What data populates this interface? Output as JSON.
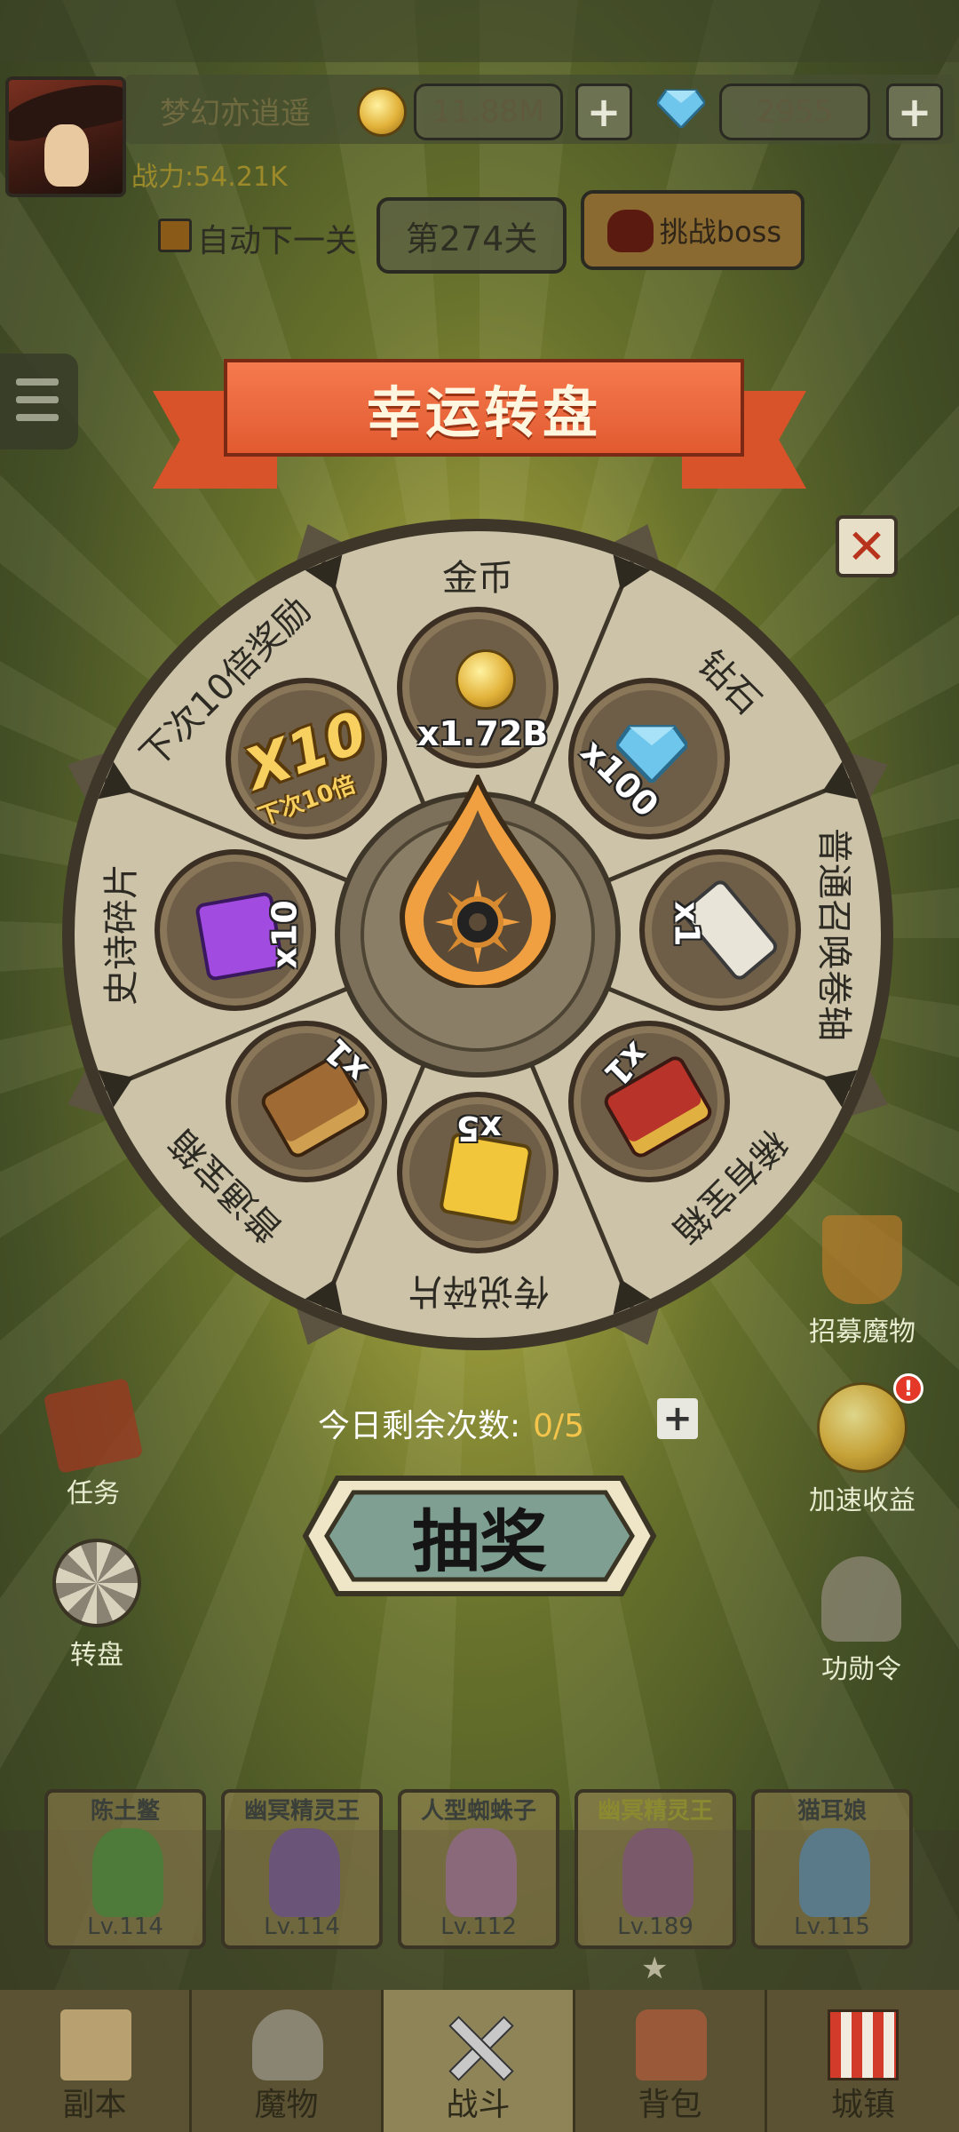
{
  "header": {
    "player_name": "梦幻亦逍遥",
    "gold": "11.88M",
    "diamonds": "2955",
    "power_label": "战力:54.21K",
    "auto_next_label": "自动下一关",
    "stage_label": "第274关",
    "boss_label": "挑战boss"
  },
  "wheel": {
    "title": "幸运转盘",
    "segments": [
      {
        "label": "金币",
        "qty": "x1.72B",
        "icon": "gold-coin-icon"
      },
      {
        "label": "钻石",
        "qty": "x100",
        "icon": "diamond-icon"
      },
      {
        "label": "普通召唤卷轴",
        "qty": "x1",
        "icon": "scroll-icon"
      },
      {
        "label": "稀有宝箱",
        "qty": "x1",
        "icon": "red-chest-icon"
      },
      {
        "label": "传说碎片",
        "qty": "x5",
        "icon": "gold-shard-icon"
      },
      {
        "label": "普通宝箱",
        "qty": "x1",
        "icon": "wood-chest-icon"
      },
      {
        "label": "史诗碎片",
        "qty": "x10",
        "icon": "purple-shard-icon"
      },
      {
        "label": "下次10倍奖励",
        "qty": "X10",
        "sub": "下次10倍",
        "icon": "x10-badge-icon"
      }
    ],
    "remaining_label": "今日剩余次数:",
    "remaining_value": "0/5",
    "draw_label": "抽奖"
  },
  "side": {
    "recruit": "招募魔物",
    "speedup": "加速收益",
    "merit": "功勋令",
    "tasks": "任务",
    "wheel": "转盘",
    "alert": "!"
  },
  "heroes": [
    {
      "name": "陈土鳖",
      "level": "Lv.114"
    },
    {
      "name": "幽冥精灵王",
      "level": "Lv.114"
    },
    {
      "name": "人型蜘蛛子",
      "level": "Lv.112"
    },
    {
      "name": "幽冥精灵王",
      "level": "Lv.189"
    },
    {
      "name": "猫耳娘",
      "level": "Lv.115"
    }
  ],
  "nav": [
    {
      "label": "副本"
    },
    {
      "label": "魔物"
    },
    {
      "label": "战斗"
    },
    {
      "label": "背包"
    },
    {
      "label": "城镇"
    }
  ],
  "colors": {
    "banner": "#e25a30",
    "wheel_face": "#ccc3a8",
    "slot": "#6e5e48",
    "draw_button": "#7f9f92",
    "gold_text": "#f5c44a"
  }
}
